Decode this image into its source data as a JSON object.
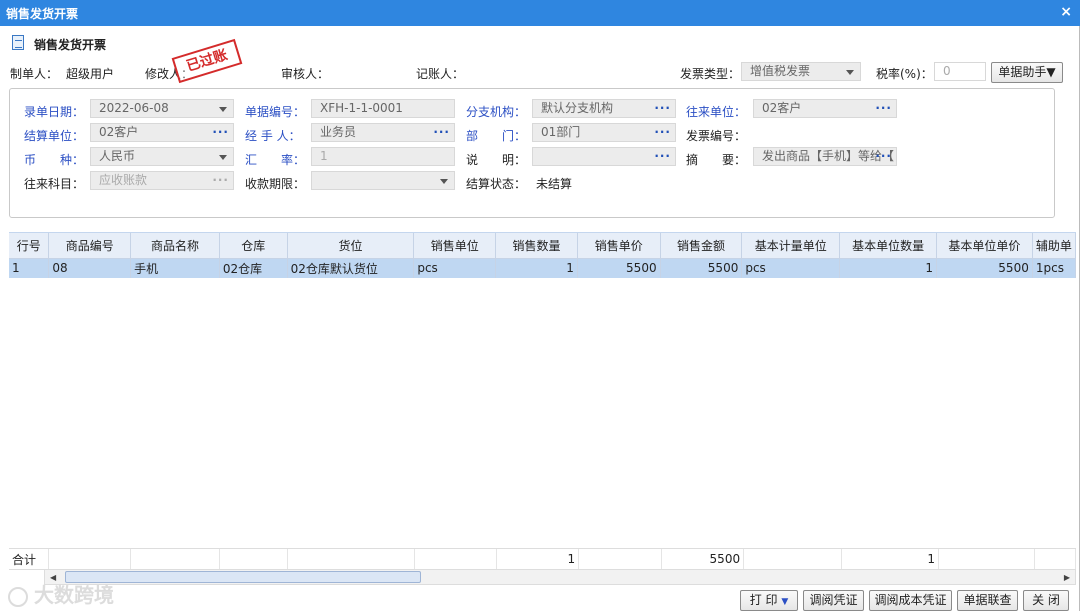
{
  "window": {
    "title": "销售发货开票",
    "close": "×"
  },
  "header": {
    "title": "销售发货开票"
  },
  "meta": {
    "maker_label": "制单人：",
    "maker_value": "超级用户",
    "modifier_label": "修改人：",
    "auditor_label": "审核人：",
    "bookkeeper_label": "记账人：",
    "invoice_type_label": "发票类型：",
    "invoice_type_value": "增值税发票",
    "tax_rate_label": "税率(%)：",
    "tax_rate_value": "0",
    "helper_button": "单据助手▼",
    "stamp": "已过账"
  },
  "form": {
    "entry_date_label": "录单日期：",
    "entry_date": "2022-06-08",
    "doc_no_label": "单据编号：",
    "doc_no": "XFH-1-1-0001",
    "branch_label": "分支机构：",
    "branch": "默认分支机构",
    "partner_label": "往来单位：",
    "partner": "02客户",
    "settle_unit_label": "结算单位：",
    "settle_unit": "02客户",
    "handler_label": "经 手 人：",
    "handler": "业务员",
    "dept_label": "部　　门：",
    "dept": "01部门",
    "invoice_no_label": "发票编号：",
    "invoice_no": "",
    "currency_label": "币　　种：",
    "currency": "人民币",
    "rate_label": "汇　　率：",
    "rate": "1",
    "note_label": "说　　明：",
    "note": "",
    "summary_label": "摘　　要：",
    "summary": "发出商品【手机】等给【",
    "account_label": "往来科目：",
    "account": "应收账款",
    "payment_term_label": "收款期限：",
    "payment_term": "",
    "settle_status_label": "结算状态：",
    "settle_status": "未结算"
  },
  "table": {
    "columns": [
      "行号",
      "商品编号",
      "商品名称",
      "仓库",
      "货位",
      "销售单位",
      "销售数量",
      "销售单价",
      "销售金额",
      "基本计量单位",
      "基本单位数量",
      "基本单位单价",
      "辅助单"
    ],
    "rows": [
      [
        "1",
        "08",
        "手机",
        "02仓库",
        "02仓库默认货位",
        "pcs",
        "1",
        "5500",
        "5500",
        "pcs",
        "1",
        "5500",
        "1pcs"
      ]
    ],
    "total_label": "合计",
    "totals": {
      "qty": "1",
      "amount": "5500",
      "base_qty": "1"
    }
  },
  "buttons": {
    "print": "打 印",
    "view_voucher": "调阅凭证",
    "view_cost_voucher": "调阅成本凭证",
    "doc_link": "单据联查",
    "close": "关 闭"
  },
  "watermark": "大数跨境"
}
